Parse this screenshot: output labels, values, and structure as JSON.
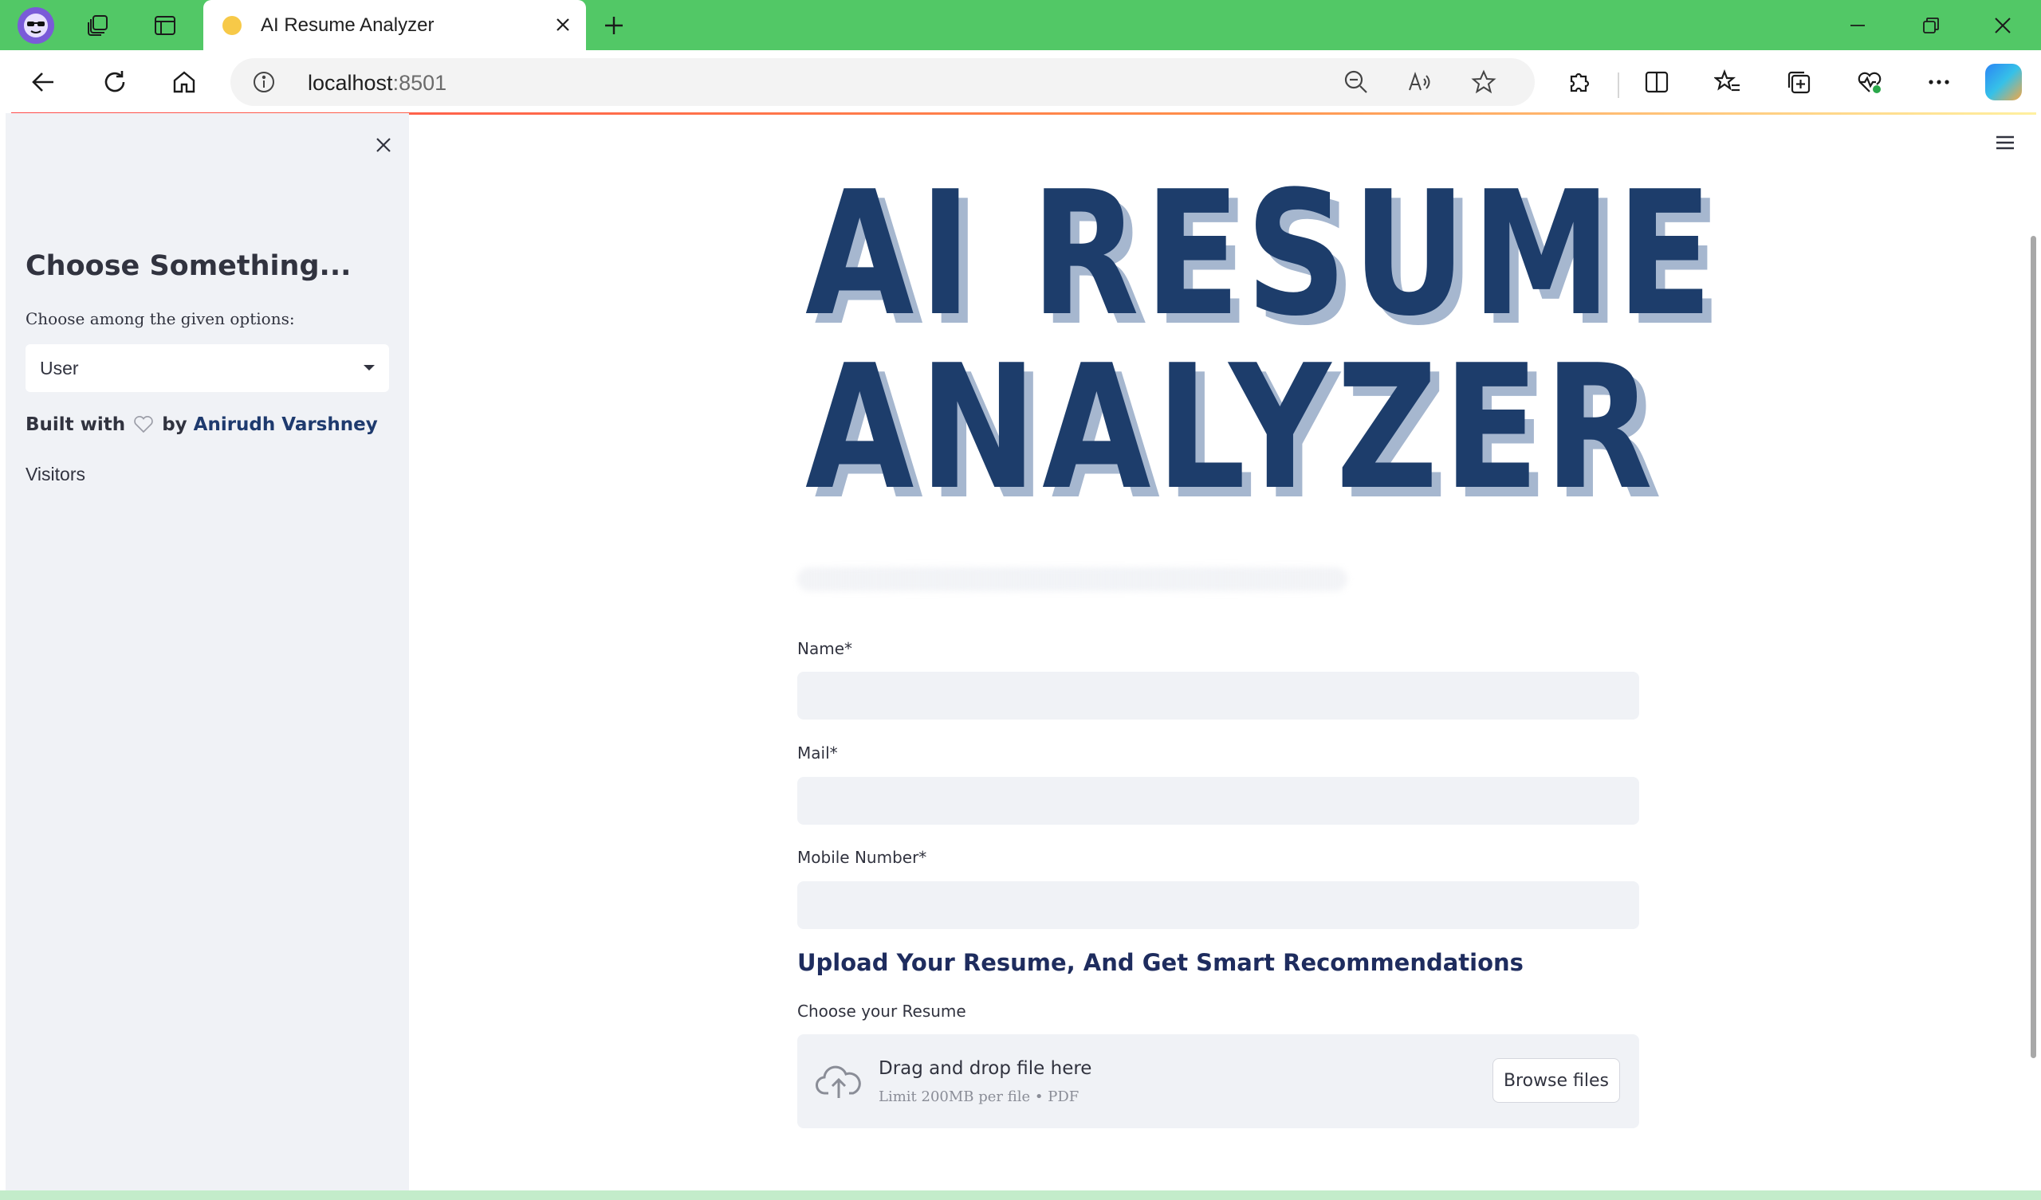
{
  "browser": {
    "tab_title": "AI Resume Analyzer",
    "url_host": "localhost",
    "url_port": ":8501",
    "accent_color": "#52c866"
  },
  "icons": {
    "profile": "profile-avatar-icon",
    "workspaces": "workspaces-icon",
    "tab_actions": "tab-actions-icon",
    "tab_favicon": "favicon-icon",
    "tab_close": "close-icon",
    "new_tab": "plus-icon",
    "back": "back-arrow-icon",
    "refresh": "refresh-icon",
    "home": "home-icon",
    "site_info": "info-icon",
    "zoom": "zoom-out-icon",
    "read_aloud": "read-aloud-icon",
    "favorite": "star-icon",
    "extensions": "puzzle-icon",
    "split_screen": "split-screen-icon",
    "favorites_list": "favorites-icon",
    "collections": "collections-icon",
    "browser_essentials": "heartbeat-icon",
    "more": "more-icon",
    "copilot": "copilot-icon"
  },
  "sidebar": {
    "heading": "Choose Something...",
    "select_label": "Choose among the given options:",
    "select_value": "User",
    "built_with_prefix": "Built with",
    "built_with_by": "by",
    "author": "Anirudh Varshney",
    "visitors": "Visitors",
    "background": "#f0f2f6"
  },
  "main": {
    "logo_line1": "AI RESUME",
    "logo_line2": "ANALYZER",
    "logo_color": "#1d3d6b",
    "fields": {
      "name_label": "Name*",
      "mail_label": "Mail*",
      "mobile_label": "Mobile Number*",
      "name_value": "",
      "mail_value": "",
      "mobile_value": ""
    },
    "upload_heading": "Upload Your Resume, And Get Smart Recommendations",
    "upload_label": "Choose your Resume",
    "dropzone_main": "Drag and drop file here",
    "dropzone_sub": "Limit 200MB per file • PDF",
    "browse_button": "Browse files"
  }
}
